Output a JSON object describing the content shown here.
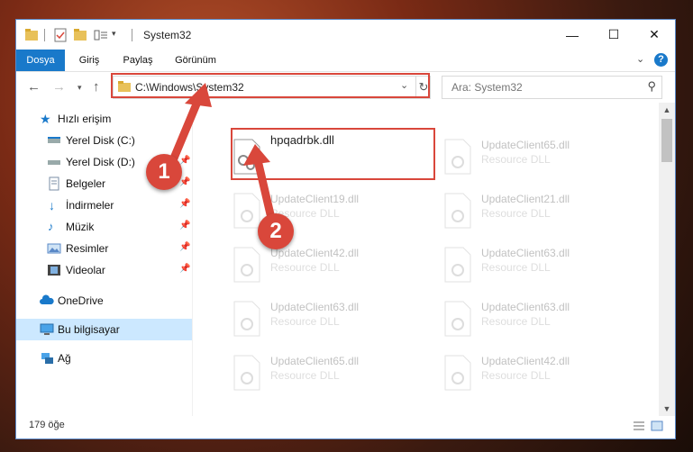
{
  "window": {
    "title": "System32",
    "controls": {
      "minimize": "—",
      "maximize": "☐",
      "close": "✕"
    }
  },
  "ribbon": {
    "tabs": [
      {
        "label": "Dosya",
        "active": true
      },
      {
        "label": "Giriş",
        "active": false
      },
      {
        "label": "Paylaş",
        "active": false
      },
      {
        "label": "Görünüm",
        "active": false
      }
    ],
    "help": "?"
  },
  "nav": {
    "address": "C:\\Windows\\System32",
    "search_placeholder": "Ara: System32"
  },
  "sidebar": {
    "items": [
      {
        "label": "Hızlı erişim",
        "icon": "star-icon",
        "pinned": false
      },
      {
        "label": "Yerel Disk (C:)",
        "icon": "drive-icon",
        "pinned": true
      },
      {
        "label": "Yerel Disk (D:)",
        "icon": "drive-icon",
        "pinned": true
      },
      {
        "label": "Belgeler",
        "icon": "documents-icon",
        "pinned": true
      },
      {
        "label": "İndirmeler",
        "icon": "download-icon",
        "pinned": true
      },
      {
        "label": "Müzik",
        "icon": "music-icon",
        "pinned": true
      },
      {
        "label": "Resimler",
        "icon": "pictures-icon",
        "pinned": true
      },
      {
        "label": "Videolar",
        "icon": "videos-icon",
        "pinned": true
      },
      {
        "label": "OneDrive",
        "icon": "cloud-icon",
        "pinned": false
      },
      {
        "label": "Bu bilgisayar",
        "icon": "computer-icon",
        "pinned": false,
        "selected": true
      },
      {
        "label": "Ağ",
        "icon": "network-icon",
        "pinned": false
      }
    ]
  },
  "files": [
    {
      "name": "hpqadrbk.dll",
      "type": "",
      "highlighted": true
    },
    {
      "name": "UpdateClient65.dll",
      "type": "Resource DLL"
    },
    {
      "name": "UpdateClient19.dll",
      "type": "Resource DLL"
    },
    {
      "name": "UpdateClient21.dll",
      "type": "Resource DLL"
    },
    {
      "name": "UpdateClient42.dll",
      "type": "Resource DLL"
    },
    {
      "name": "UpdateClient63.dll",
      "type": "Resource DLL"
    },
    {
      "name": "UpdateClient63.dll",
      "type": "Resource DLL"
    },
    {
      "name": "UpdateClient63.dll",
      "type": "Resource DLL"
    },
    {
      "name": "UpdateClient65.dll",
      "type": "Resource DLL"
    },
    {
      "name": "UpdateClient42.dll",
      "type": "Resource DLL"
    }
  ],
  "status": {
    "count": "179 öğe"
  },
  "callouts": [
    "1",
    "2"
  ],
  "colors": {
    "accent": "#1979ca",
    "highlight": "#d9473b",
    "selected": "#cce8ff"
  }
}
